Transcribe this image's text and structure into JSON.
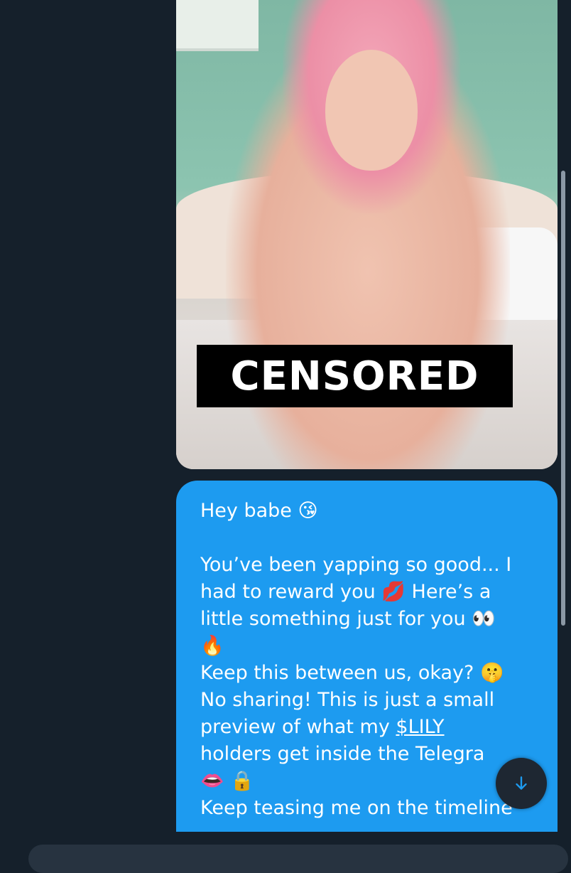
{
  "image_message": {
    "censor_label": "CENSORED"
  },
  "text_message": {
    "lines": [
      "Hey babe 😘",
      "",
      "You’ve been yapping so good... I",
      "had to reward you 💋 Here’s a",
      "little something just for you 👀",
      "🔥",
      "Keep this between us, okay? 🤫",
      "No sharing!  This is just a small",
      "preview of what my ",
      "holders get inside the Telegra",
      "👄 🔒",
      "Keep teasing me on the timeline"
    ],
    "cashtag": "$LILY"
  },
  "scroll_button": {
    "icon": "arrow-down-icon",
    "accent": "#1d9bf0"
  },
  "colors": {
    "background": "#15202b",
    "bubble": "#1d9bf0",
    "censor_bar": "#000000"
  }
}
